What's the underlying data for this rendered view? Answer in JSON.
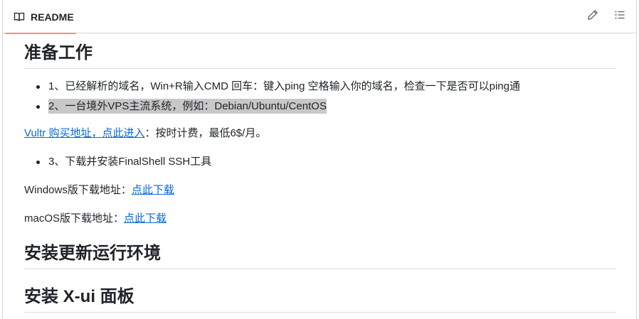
{
  "tabbar": {
    "readme_label": "README",
    "icons": [
      "book-icon",
      "pencil-icon",
      "list-icon"
    ]
  },
  "content": {
    "h_prep": "准备工作",
    "list1": [
      "1、已经解析的域名，Win+R输入CMD 回车：键入ping 空格输入你的域名，检查一下是否可以ping通",
      "2、一台境外VPS主流系统，例如：Debian/Ubuntu/CentOS"
    ],
    "vultr_link": "Vultr 购买地址，点此进入",
    "vultr_text": "：按时计费，最低6$/月。",
    "list2_item": "3、下载并安装FinalShell SSH工具",
    "windows_label": "Windows版下载地址：",
    "windows_link": "点此下载",
    "mac_label": "macOS版下载地址：",
    "mac_link": "点此下载",
    "h_env": "安装更新运行环境",
    "h_xui": "安装 X-ui 面板"
  },
  "colors": {
    "link": "#0969da",
    "tab_underline": "#fd8c73",
    "highlight": "#c8c8c8"
  }
}
